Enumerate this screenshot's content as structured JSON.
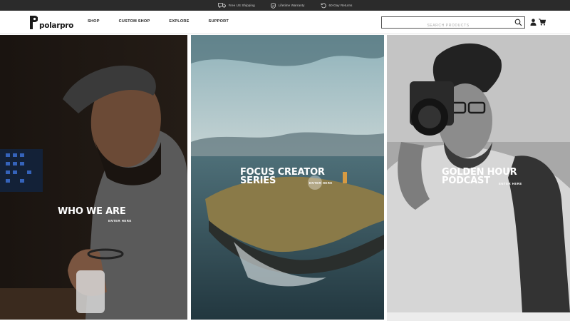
{
  "topbar": {
    "perks": [
      {
        "icon": "truck-icon",
        "label": "Free US Shipping"
      },
      {
        "icon": "shield-icon",
        "label": "Lifetime Warranty"
      },
      {
        "icon": "return-arrow-icon",
        "label": "60-Day Returns"
      }
    ]
  },
  "header": {
    "logo_text": "polarpro",
    "nav": [
      "SHOP",
      "CUSTOM SHOP",
      "EXPLORE",
      "SUPPORT"
    ],
    "search_placeholder": "SEARCH PRODUCTS",
    "icons": [
      "search-icon",
      "user-icon",
      "cart-icon"
    ]
  },
  "panels": [
    {
      "title": "WHO WE ARE",
      "cta": "ENTER HERE"
    },
    {
      "title": "FOCUS CREATOR\nSERIES",
      "cta": "ENTER HERE"
    },
    {
      "title": "GOLDEN HOUR\nPODCAST",
      "cta": "ENTER HERE"
    }
  ],
  "colors": {
    "topbar_bg": "#2b2b2b",
    "text_dark": "#1a1a1a",
    "panel_text": "#ffffff"
  }
}
